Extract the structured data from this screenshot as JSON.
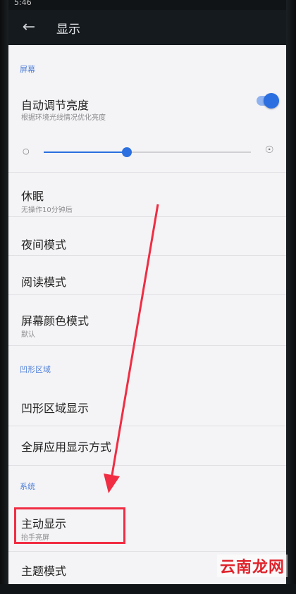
{
  "status_bar": {
    "time": "5:46",
    "right": ""
  },
  "header": {
    "back_icon": "arrow-back-icon",
    "title": "显示"
  },
  "sections": {
    "screen": "屏幕",
    "notch": "凹形区域",
    "system": "系统"
  },
  "auto_brightness": {
    "title": "自动调节亮度",
    "subtitle": "根据环境光线情况优化亮度",
    "enabled": true
  },
  "brightness": {
    "level": 0.4
  },
  "items": {
    "sleep": {
      "title": "休眠",
      "subtitle": "无操作10分钟后"
    },
    "night_mode": {
      "title": "夜间模式"
    },
    "reading_mode": {
      "title": "阅读模式"
    },
    "color_mode": {
      "title": "屏幕颜色模式",
      "subtitle": "默认"
    },
    "notch_display": {
      "title": "凹形区域显示"
    },
    "fullscreen_apps": {
      "title": "全屏应用显示方式"
    },
    "active_display": {
      "title": "主动显示",
      "subtitle": "抬手亮屏"
    },
    "theme_mode": {
      "title": "主题模式"
    }
  },
  "watermark": "云南龙网",
  "colors": {
    "accent": "#2b6fe0",
    "highlight": "#f02d43"
  }
}
